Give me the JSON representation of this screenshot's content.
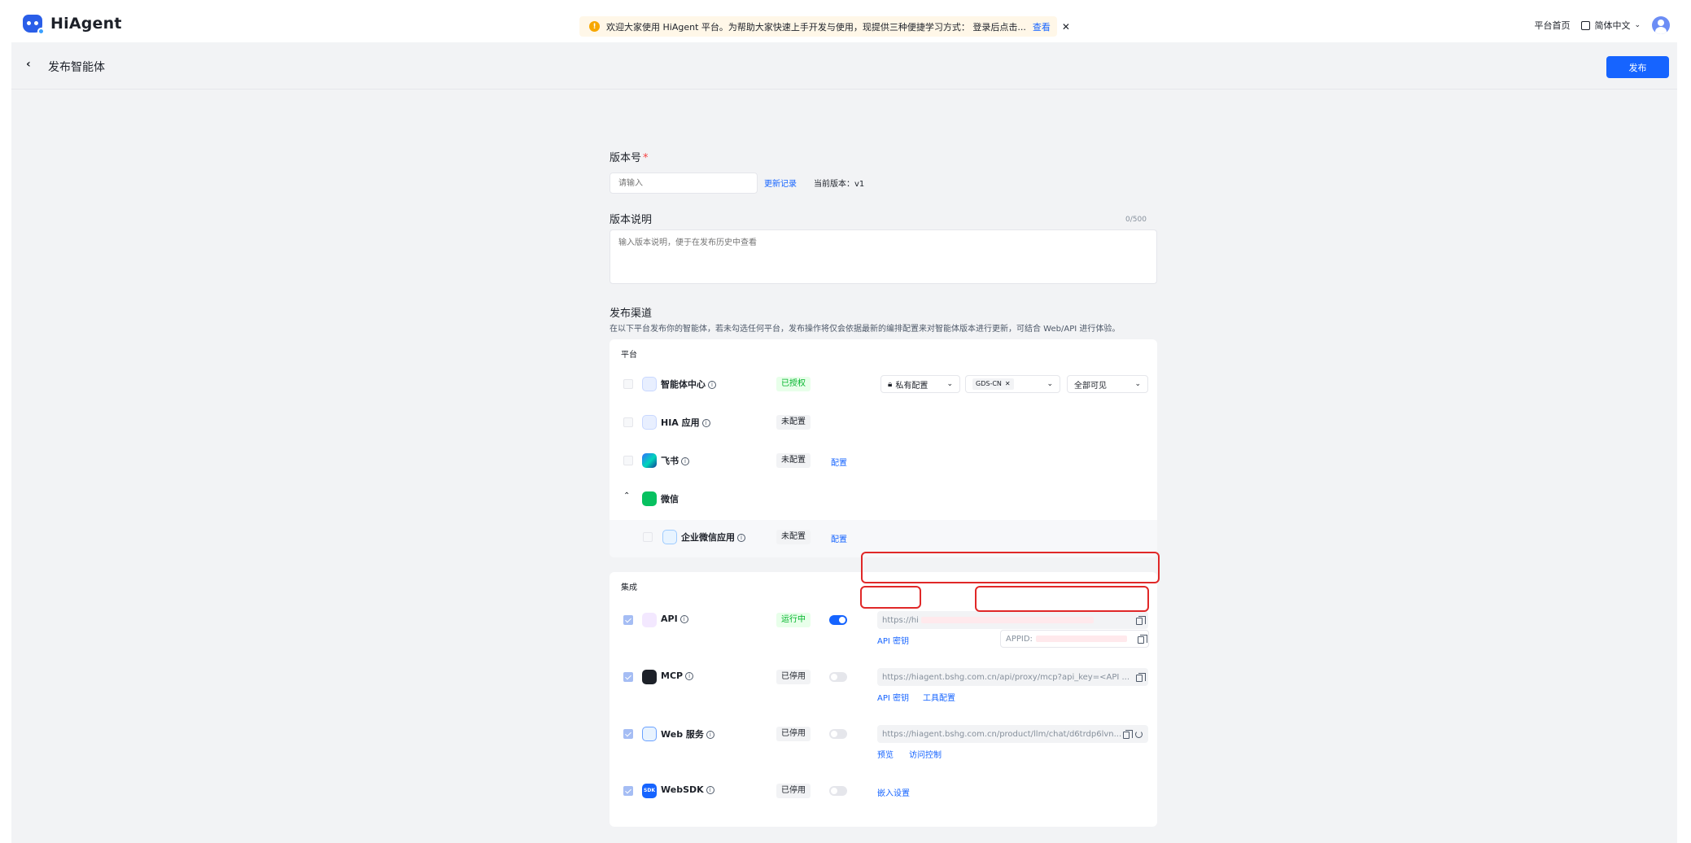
{
  "header": {
    "brand": "HiAgent",
    "notice_text": "欢迎大家使用 HiAgent 平台。为帮助大家快速上手开发与使用，现提供三种便捷学习方式： 登录后点击...",
    "notice_link": "查看",
    "nav_home": "平台首页",
    "language": "简体中文"
  },
  "page": {
    "back": "‹",
    "title": "发布智能体",
    "publish_label": "发布"
  },
  "form": {
    "version_label": "版本号",
    "version_placeholder": "请输入",
    "update_record": "更新记录",
    "current_version": "当前版本：v1",
    "desc_label": "版本说明",
    "desc_count": "0/500",
    "desc_placeholder": "输入版本说明，便于在发布历史中查看",
    "channel_label": "发布渠道",
    "channel_hint": "在以下平台发布你的智能体，若未勾选任何平台，发布操作将仅会依据最新的编排配置来对智能体版本进行更新，可结合 Web/API 进行体验。"
  },
  "platform": {
    "section_title": "平台",
    "rows": [
      {
        "name": "智能体中心",
        "status": "已授权"
      },
      {
        "name": "HIA 应用",
        "status": "未配置"
      },
      {
        "name": "飞书",
        "status": "未配置",
        "action": "配置"
      },
      {
        "name": "微信"
      },
      {
        "name": "企业微信应用",
        "status": "未配置",
        "action": "配置"
      }
    ],
    "private_config": "私有配置",
    "region_chip": "GDS-CN",
    "visibility": "全部可见"
  },
  "integration": {
    "section_title": "集成",
    "rows": [
      {
        "name": "API",
        "status": "运行中",
        "url": "https://hi",
        "links": [
          "API 密钥"
        ],
        "appid_label": "APPID:"
      },
      {
        "name": "MCP",
        "status": "已停用",
        "url": "https://hiagent.bshg.com.cn/api/proxy/mcp?api_key=<API ...",
        "links": [
          "API 密钥",
          "工具配置"
        ]
      },
      {
        "name": "Web 服务",
        "status": "已停用",
        "url": "https://hiagent.bshg.com.cn/product/llm/chat/d6trdp6lvn...",
        "links": [
          "预览",
          "访问控制"
        ]
      },
      {
        "name": "WebSDK",
        "status": "已停用",
        "links": [
          "嵌入设置"
        ]
      }
    ]
  },
  "icons": {
    "notice": "warning-icon",
    "back": "chevron-left-icon",
    "info": "info-icon",
    "copy": "copy-icon",
    "refresh": "refresh-icon",
    "lock": "lock-icon",
    "chevron": "chevron-down-icon"
  },
  "colors": {
    "primary": "#1664ff",
    "success": "#00b42a",
    "annotation": "#e02828",
    "background": "#f2f3f5"
  }
}
